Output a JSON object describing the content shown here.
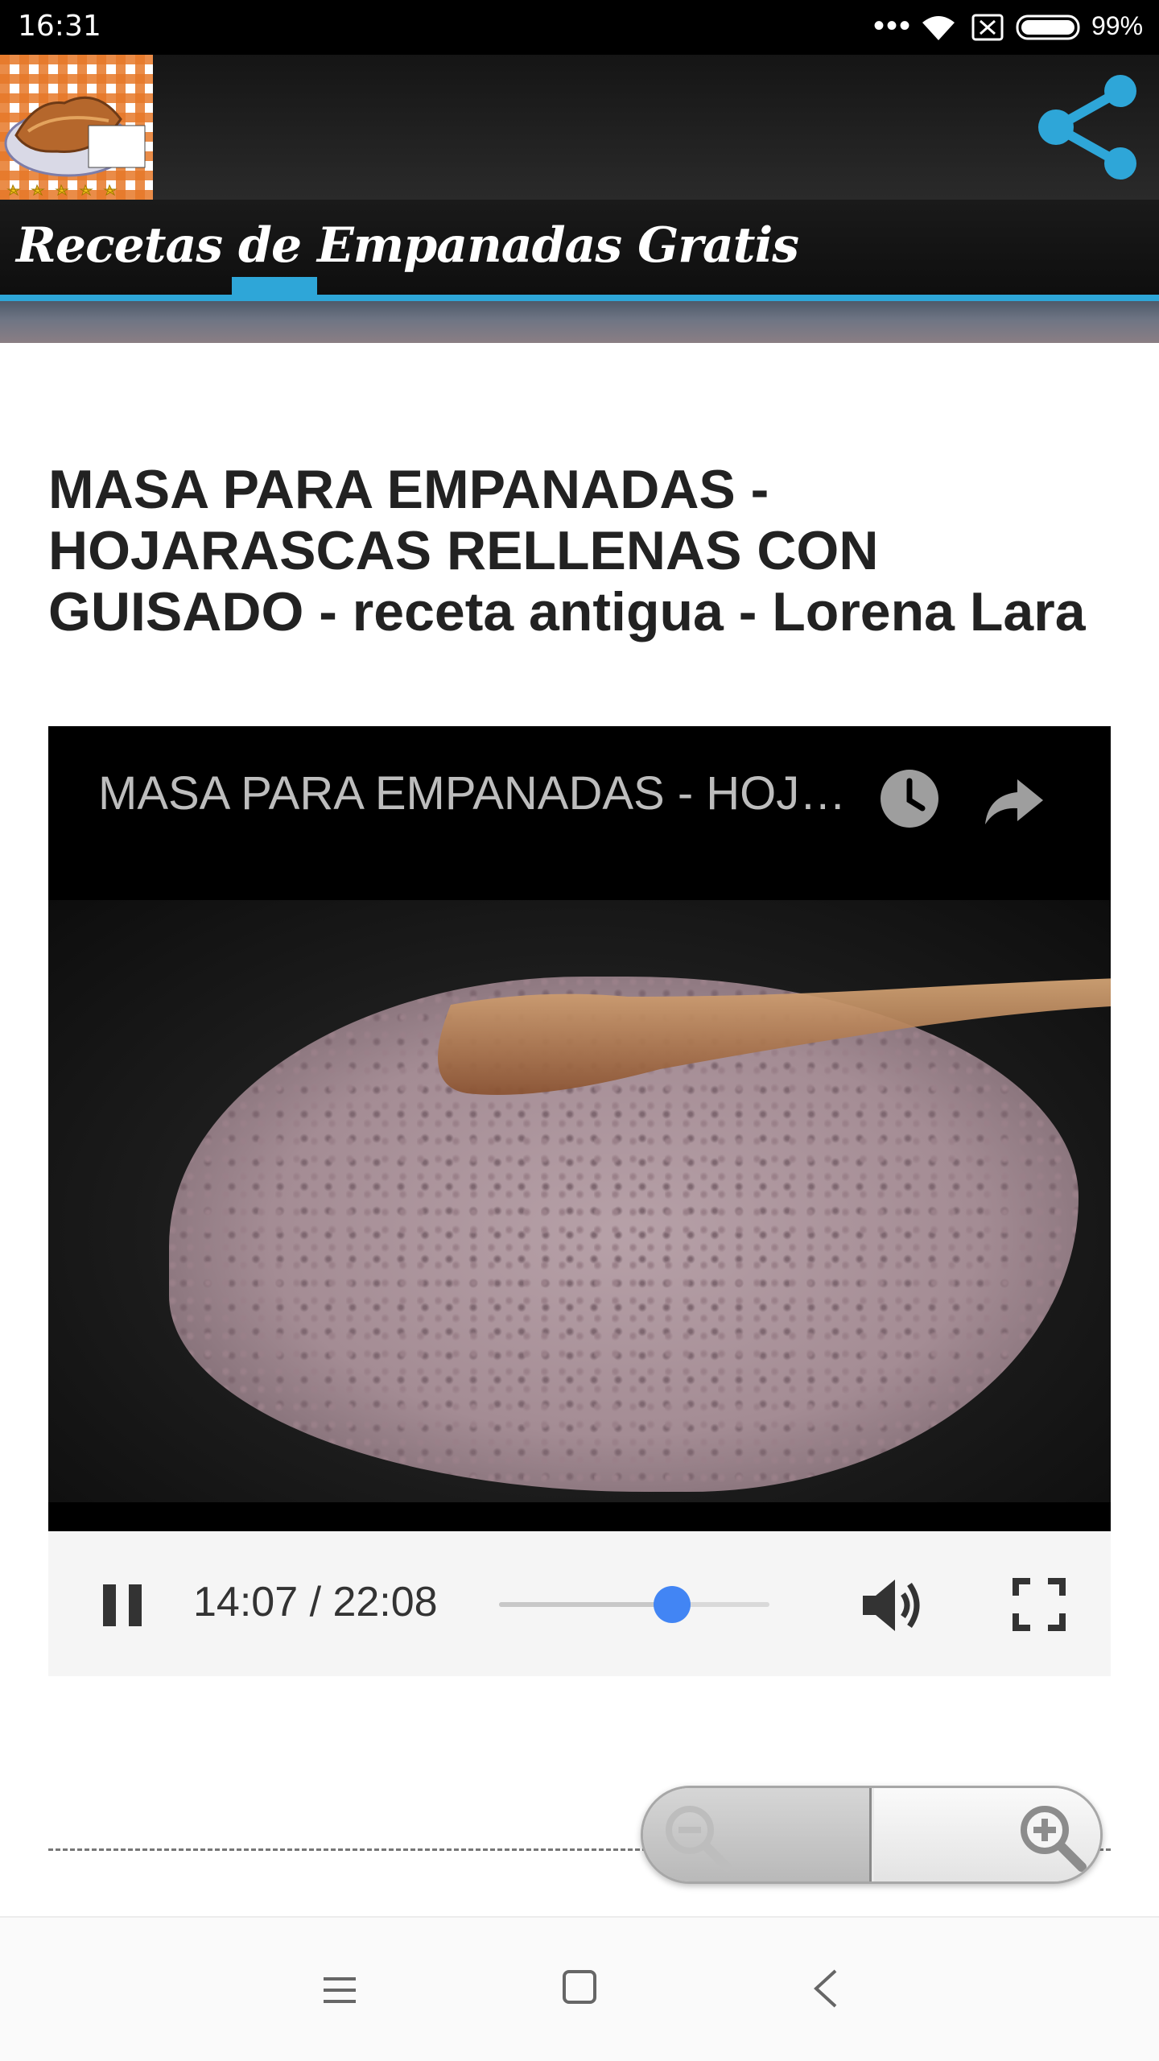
{
  "status_bar": {
    "time": "16:31",
    "dots": "•••",
    "battery": "99%",
    "icons": [
      "wifi-icon",
      "sim-icon",
      "battery-icon"
    ]
  },
  "app_bar": {
    "logo_icon": "app-logo",
    "share_icon": "share-icon"
  },
  "title_strip": {
    "title": "Recetas de Empanadas Gratis",
    "accent_color": "#2ea6d8"
  },
  "article": {
    "title": "MASA PARA EMPANADAS - HOJARASCAS RELLENAS CON GUISADO - receta antigua - Lorena Lara"
  },
  "video": {
    "title": "MASA PARA EMPANADAS - HOJARASCAS RELLENAS CON GUISADO - receta antigua - Lorena Lara",
    "icons": [
      "clock-icon",
      "forward-icon"
    ]
  },
  "controls": {
    "time": "14:07 / 22:08",
    "progress": 0.64,
    "seek_color": "#4285f4",
    "icons": [
      "pause-icon",
      "volume-icon",
      "fullscreen-icon"
    ]
  },
  "zoom": {
    "icons": [
      "zoom-out-icon",
      "zoom-in-icon"
    ]
  },
  "nav_bar": {
    "icons": [
      "menu-icon",
      "home-icon",
      "back-icon"
    ]
  }
}
